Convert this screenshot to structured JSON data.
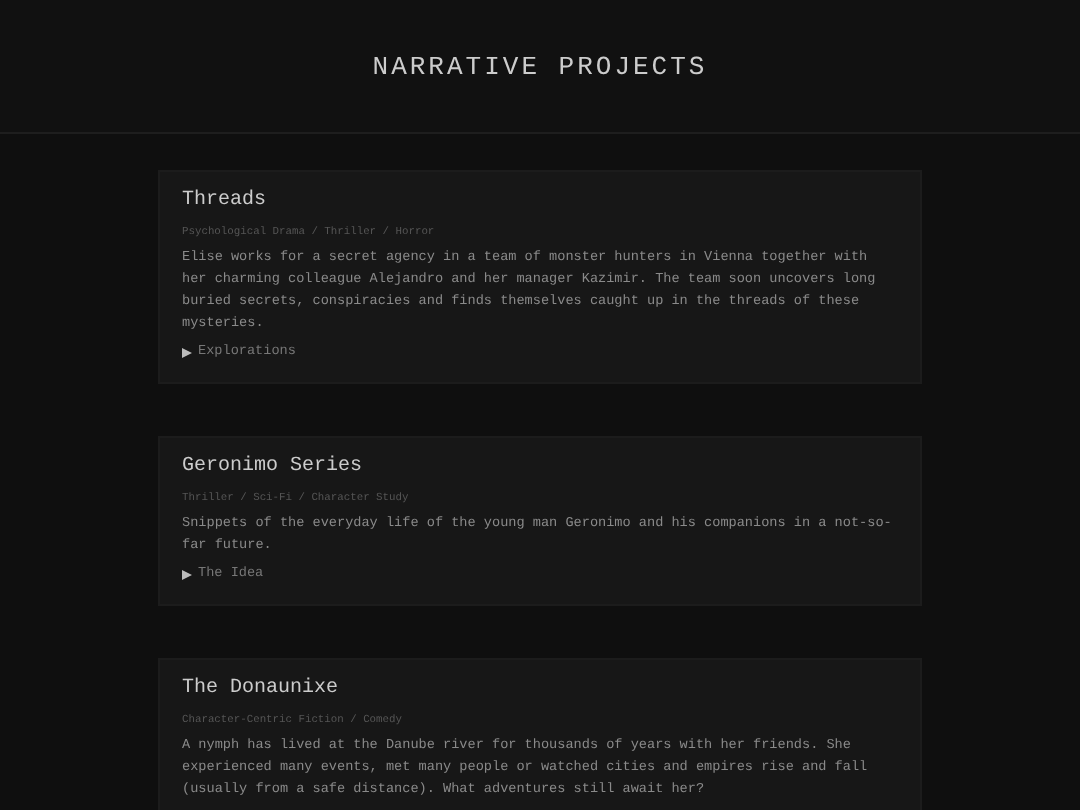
{
  "header": {
    "title": "NARRATIVE PROJECTS"
  },
  "projects": [
    {
      "title": "Threads",
      "genres": "Psychological Drama / Thriller / Horror",
      "description": "Elise works for a secret agency in a team of monster hunters in Vienna together with her charming colleague Alejandro and her manager Kazimir. The team soon uncovers long buried secrets, conspiracies and finds themselves caught up in the threads of these mysteries.",
      "disclosure": {
        "label": "Explorations",
        "expanded": false
      }
    },
    {
      "title": "Geronimo Series",
      "genres": "Thriller / Sci-Fi / Character Study",
      "description": "Snippets of the everyday life of the young man Geronimo and his companions in a not-so-far future.",
      "disclosure": {
        "label": "The Idea",
        "expanded": false
      }
    },
    {
      "title": "The Donaunixe",
      "genres": "Character-Centric Fiction / Comedy",
      "description": "A nymph has lived at the Danube river for thousands of years with her friends. She experienced many events, met many people or watched cities and empires rise and fall (usually from a safe distance). What adventures still await her?"
    }
  ]
}
